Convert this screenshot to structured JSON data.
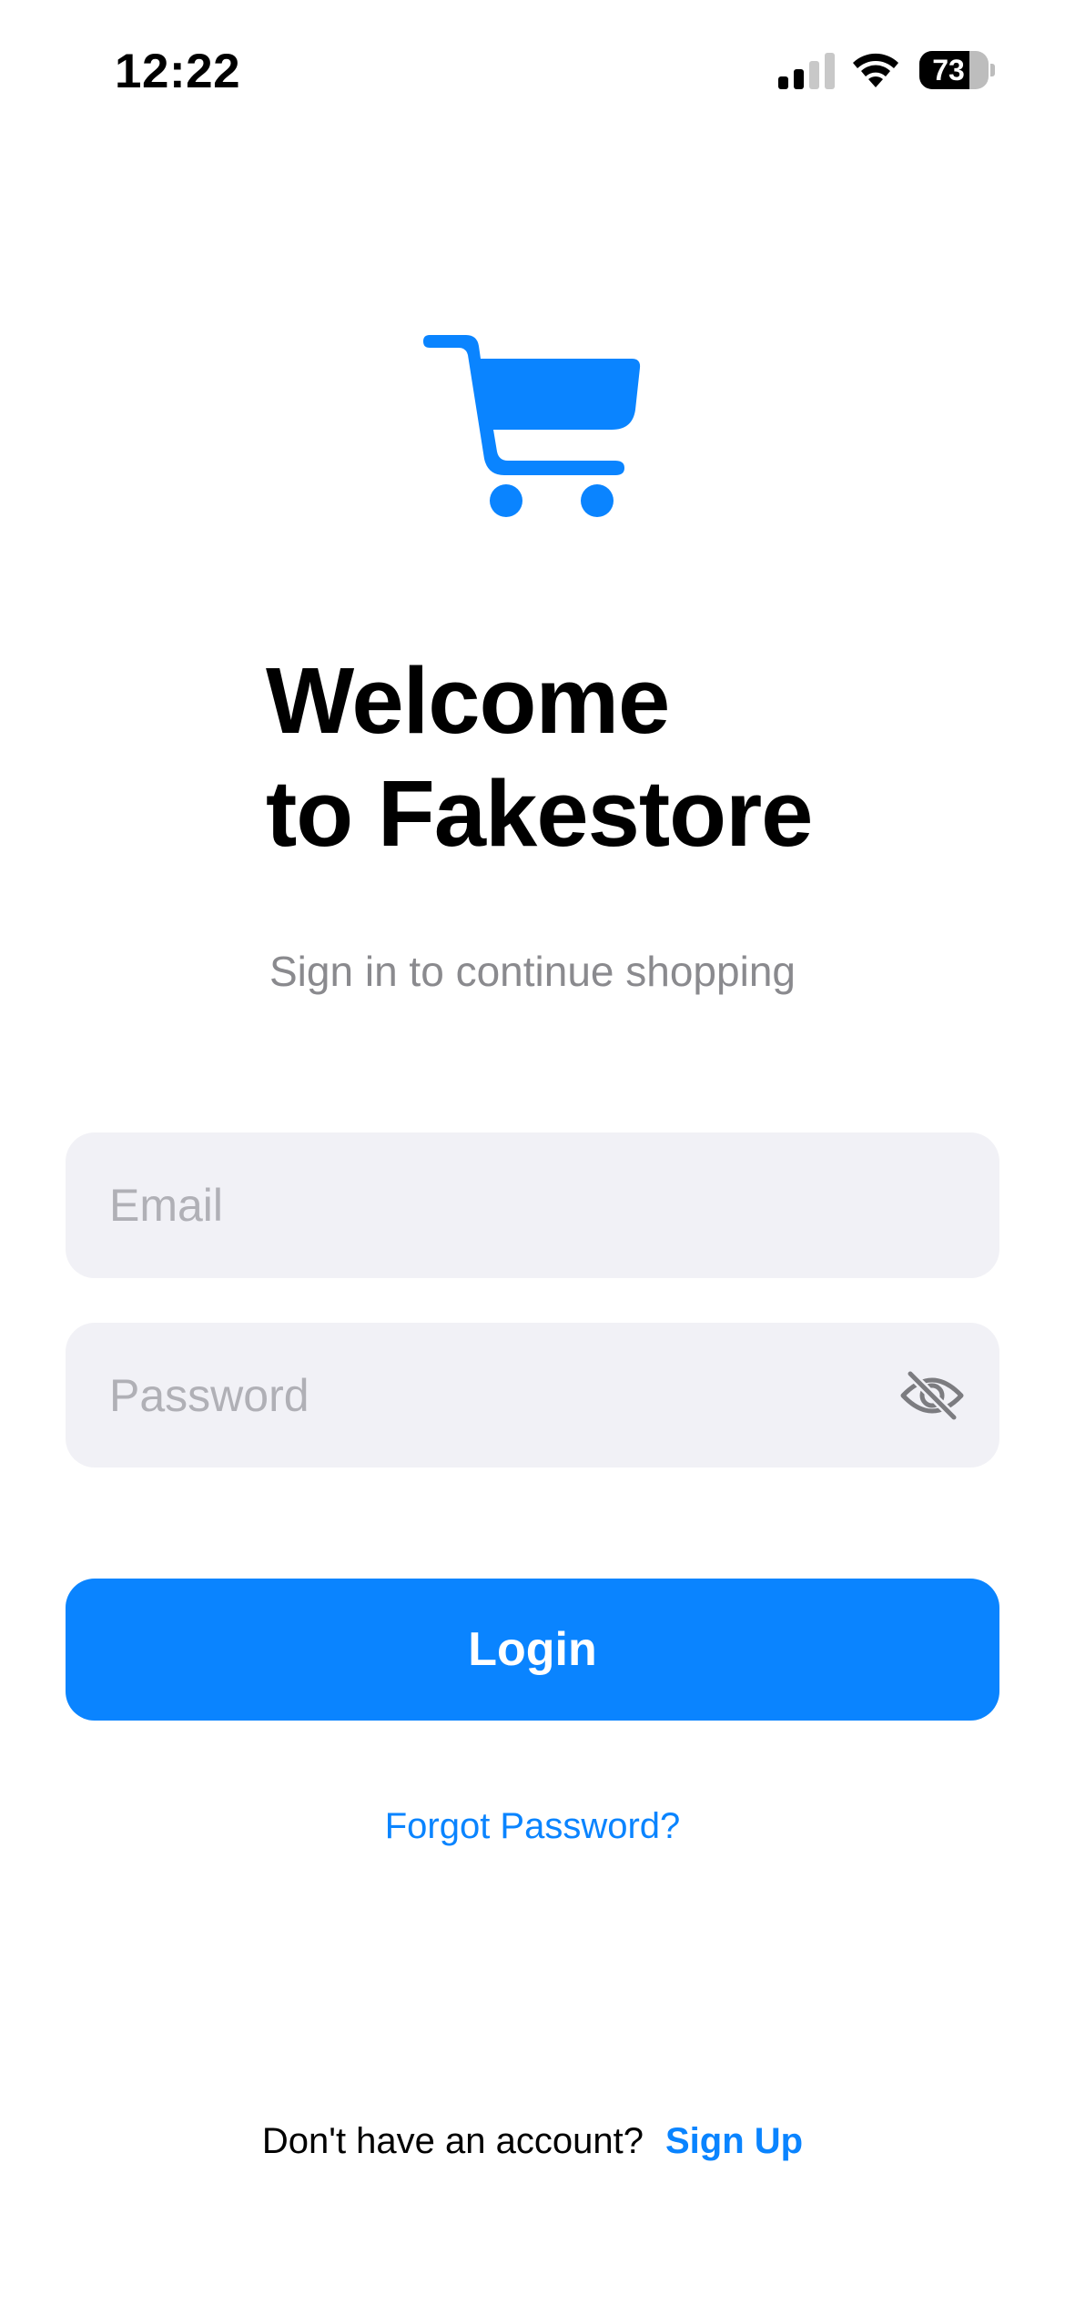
{
  "status_bar": {
    "time": "12:22",
    "battery_level": "73",
    "battery_fraction": 0.73,
    "signal_icon": "cellular-signal-icon",
    "wifi_icon": "wifi-icon"
  },
  "logo": {
    "icon": "shopping-cart-icon",
    "color": "#0a84ff"
  },
  "welcome": {
    "line1": "Welcome",
    "line2": "to Fakestore",
    "subtitle": "Sign in to continue shopping"
  },
  "form": {
    "email_placeholder": "Email",
    "email_value": "",
    "password_placeholder": "Password",
    "password_value": "",
    "password_toggle_icon": "eye-slash-icon",
    "login_label": "Login",
    "forgot_password_label": "Forgot Password?"
  },
  "signup": {
    "prompt": "Don't have an account?",
    "link_label": "Sign Up"
  },
  "colors": {
    "accent": "#0a84ff",
    "field_background": "#f1f1f6",
    "muted_text": "#8a8a8e"
  }
}
